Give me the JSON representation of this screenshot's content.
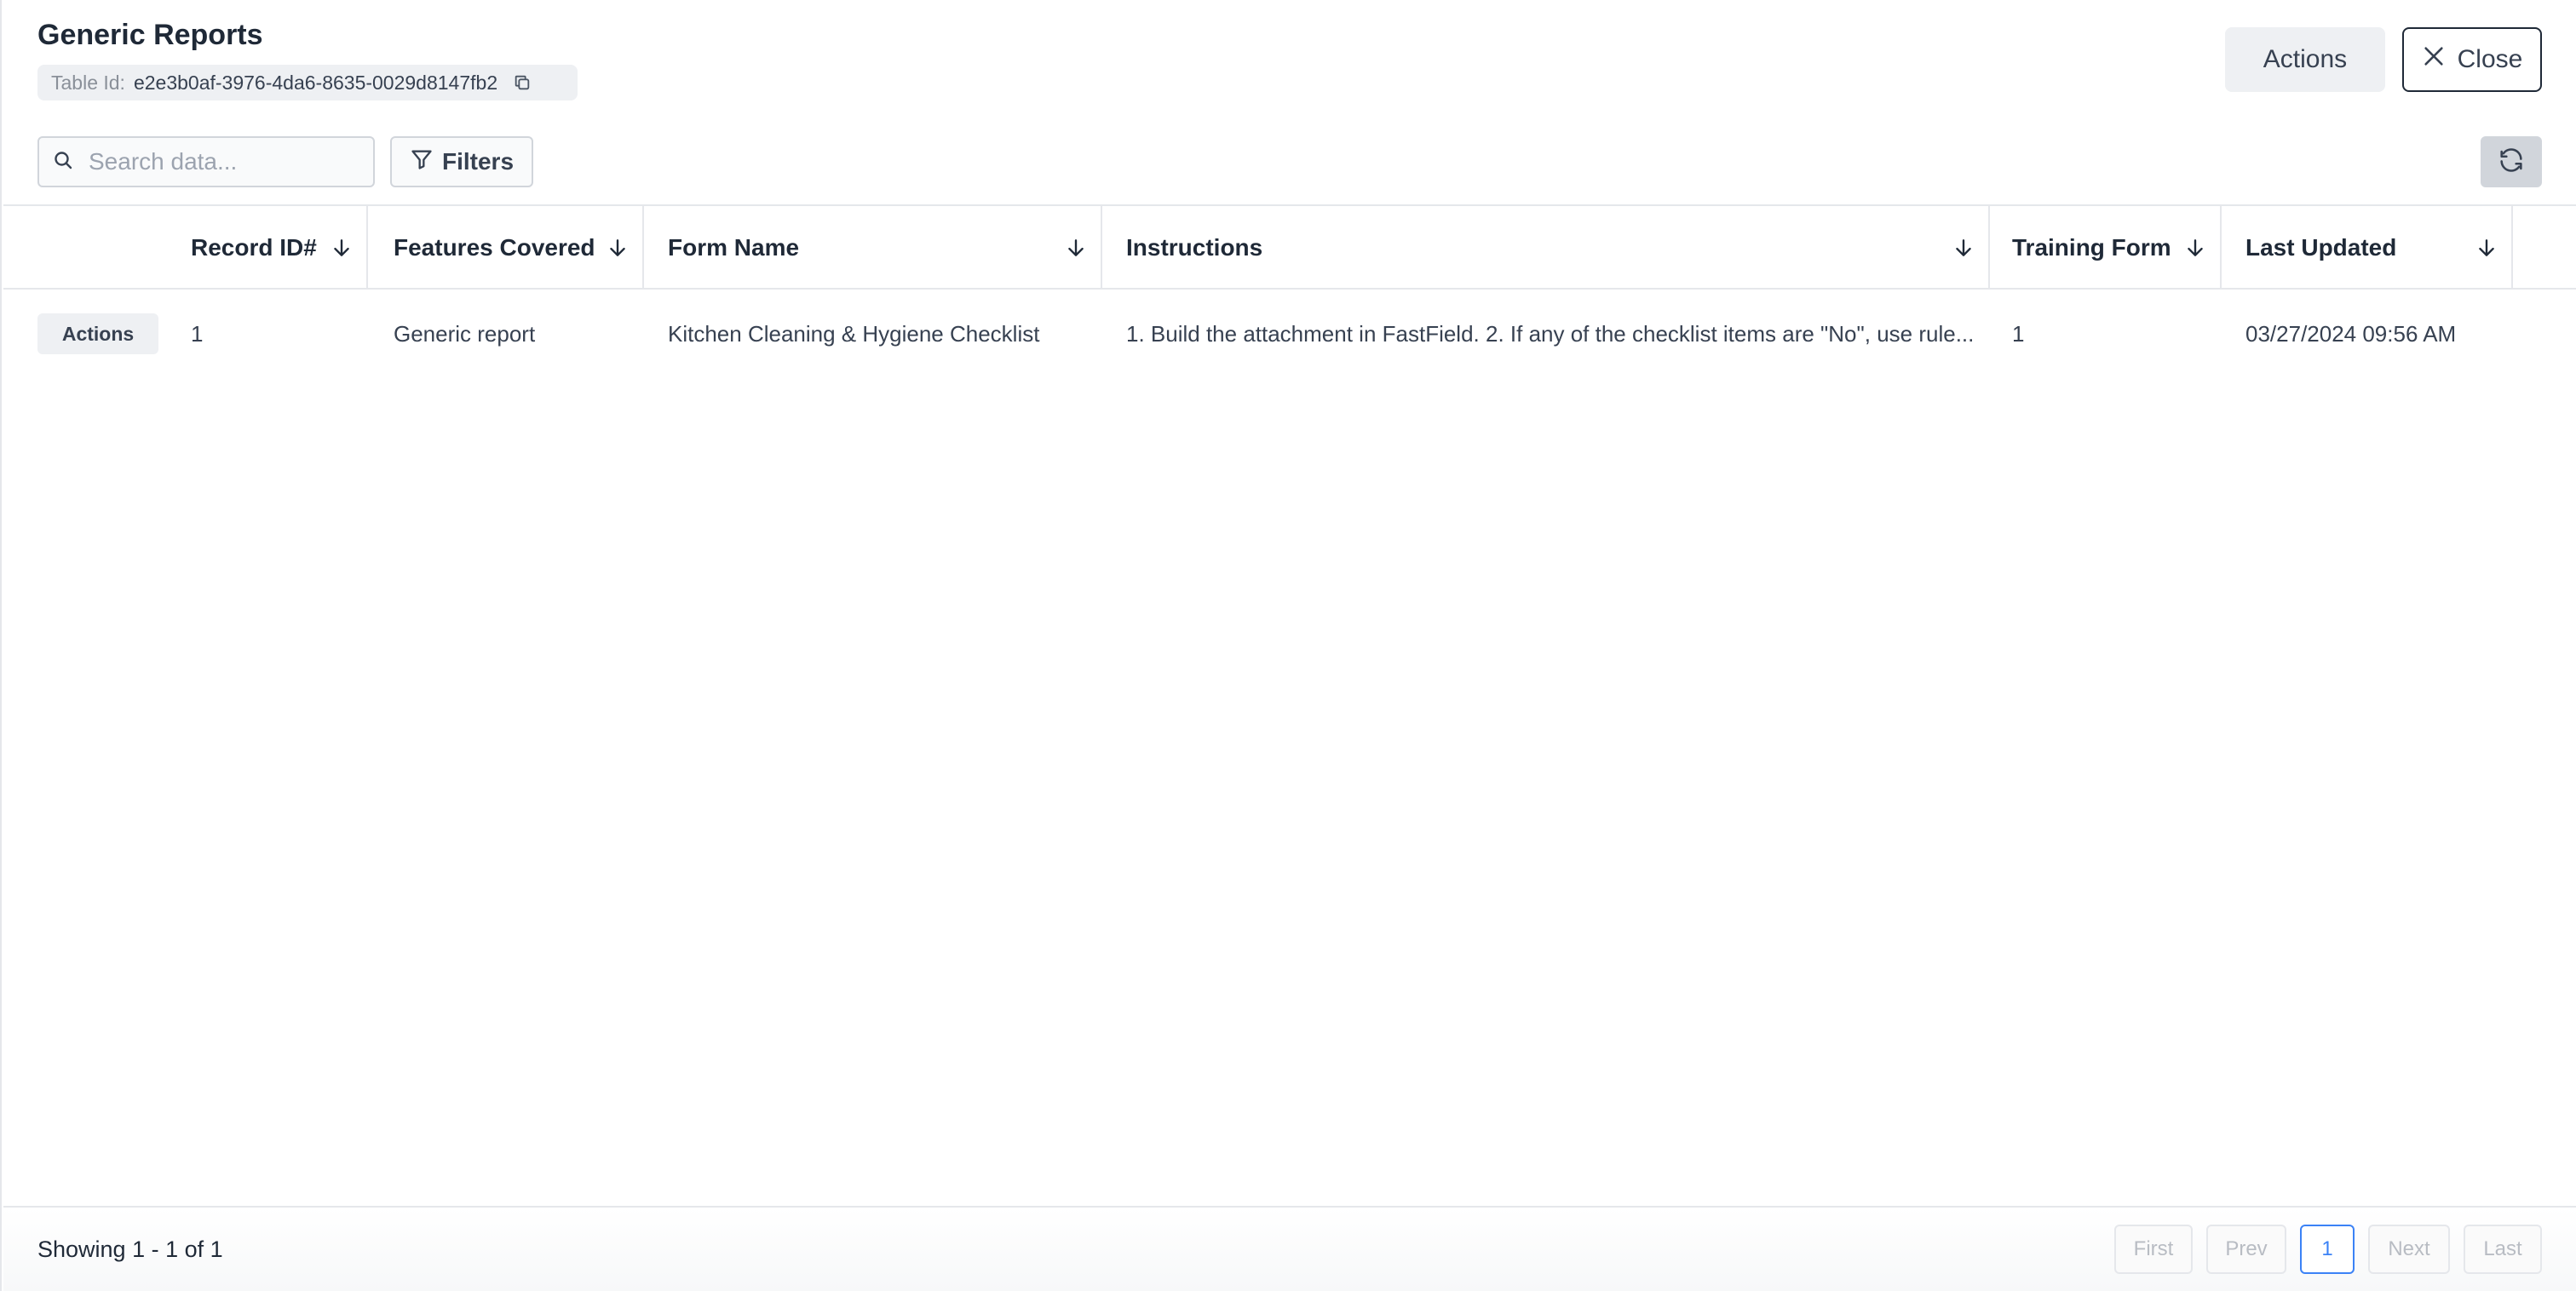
{
  "header": {
    "title": "Generic Reports",
    "table_id_label": "Table Id:",
    "table_id_value": "e2e3b0af-3976-4da6-8635-0029d8147fb2",
    "actions_label": "Actions",
    "close_label": "Close"
  },
  "toolbar": {
    "search_placeholder": "Search data...",
    "filters_label": "Filters"
  },
  "table": {
    "columns": [
      "Record ID#",
      "Features Covered",
      "Form Name",
      "Instructions",
      "Training Form",
      "Last Updated"
    ],
    "rows": [
      {
        "actions_label": "Actions",
        "record_id": "1",
        "features_covered": "Generic report",
        "form_name": "Kitchen Cleaning & Hygiene Checklist",
        "instructions": "1. Build the attachment in FastField. 2. If any of the checklist items are \"No\", use rule...",
        "training_form": "1",
        "last_updated": "03/27/2024 09:56 AM"
      }
    ]
  },
  "footer": {
    "showing": "Showing 1 - 1 of 1",
    "pagination": {
      "first": "First",
      "prev": "Prev",
      "current": "1",
      "next": "Next",
      "last": "Last"
    }
  }
}
